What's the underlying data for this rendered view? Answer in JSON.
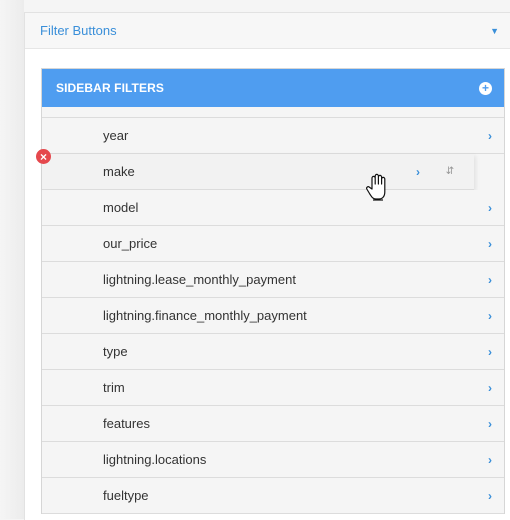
{
  "panel": {
    "title": "Filter Buttons",
    "collapse_icon": "caret-down-icon"
  },
  "card": {
    "title": "SIDEBAR FILTERS",
    "add_icon": "plus-circle-icon"
  },
  "filters": [
    {
      "label": "year"
    },
    {
      "label": "make"
    },
    {
      "label": "model"
    },
    {
      "label": "our_price"
    },
    {
      "label": "lightning.lease_monthly_payment"
    },
    {
      "label": "lightning.finance_monthly_payment"
    },
    {
      "label": "type"
    },
    {
      "label": "trim"
    },
    {
      "label": "features"
    },
    {
      "label": "lightning.locations"
    },
    {
      "label": "fueltype"
    }
  ],
  "icons": {
    "row_chevron": "chevron-right-icon",
    "remove": "remove-circle-icon",
    "sort": "sort-handle-icon",
    "cursor": "grab-hand-cursor-icon"
  },
  "colors": {
    "accent": "#3a8fd9",
    "card_header": "#4f9df0",
    "remove": "#e5484d"
  }
}
